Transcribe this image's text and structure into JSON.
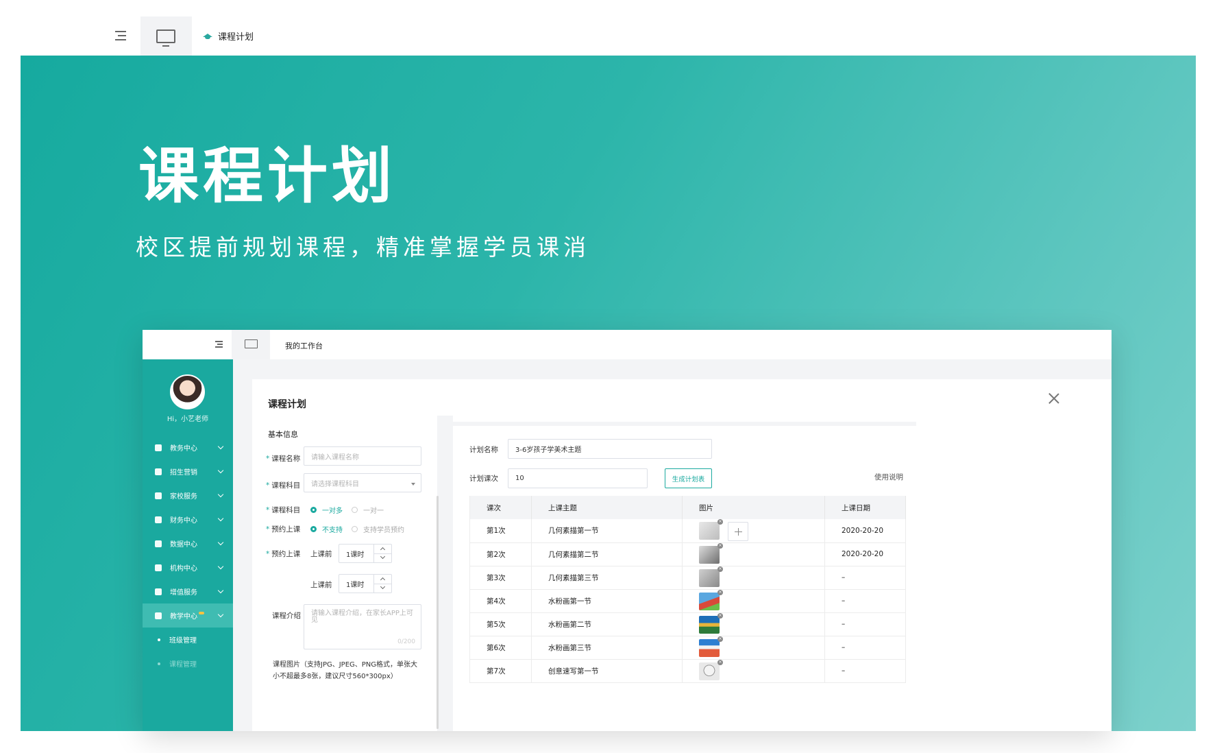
{
  "header": {
    "tab_label": "课程计划"
  },
  "hero": {
    "title": "课程计划",
    "subtitle": "校区提前规划课程，精准掌握学员课消"
  },
  "app": {
    "top_tab": "我的工作台",
    "greeting": "Hi，小艺老师",
    "nav": [
      {
        "label": "教务中心",
        "icon": "grid-icon"
      },
      {
        "label": "招生营销",
        "icon": "book-icon"
      },
      {
        "label": "家校服务",
        "icon": "heart-icon"
      },
      {
        "label": "财务中心",
        "icon": "wallet-icon"
      },
      {
        "label": "数据中心",
        "icon": "bar-chart-icon"
      },
      {
        "label": "机构中心",
        "icon": "building-icon"
      },
      {
        "label": "增值服务",
        "icon": "gem-icon"
      },
      {
        "label": "教学中心",
        "icon": "graduation-cap-icon"
      }
    ],
    "subnav": [
      "班级管理",
      "课程管理"
    ],
    "accent_color": "#1aa99f"
  },
  "panel": {
    "title": "课程计划",
    "section": "基本信息",
    "form": {
      "name_label": "课程名称",
      "name_placeholder": "请输入课程名称",
      "subject_label": "课程科目",
      "subject_placeholder": "请选择课程科目",
      "type_label": "课程科目",
      "type_options": [
        "一对多",
        "一对一"
      ],
      "book_label": "预约上课",
      "book_options": [
        "不支持",
        "支持学员预约"
      ],
      "book2_label": "预约上课",
      "before_label1": "上课前",
      "before_value1": "1课时",
      "before_label2": "上课前",
      "before_value2": "1课时",
      "intro_label": "课程介绍",
      "intro_placeholder": "请输入课程介绍，在家长APP上可见",
      "intro_counter": "0/200",
      "image_note": "课程图片（支持JPG、JPEG、PNG格式，单张大小不超最多8张，建议尺寸560*300px）"
    },
    "plan": {
      "name_label": "计划名称",
      "name_value": "3-6岁孩子学美术主题",
      "count_label": "计划课次",
      "count_value": "10",
      "generate_button": "生成计划表",
      "help_link": "使用说明"
    },
    "table": {
      "headers": [
        "课次",
        "上课主题",
        "图片",
        "上课日期"
      ],
      "rows": [
        {
          "no": "第1次",
          "topic": "几何素描第一节",
          "date": "2020-20-20"
        },
        {
          "no": "第2次",
          "topic": "几何素描第二节",
          "date": "2020-20-20"
        },
        {
          "no": "第3次",
          "topic": "几何素描第三节",
          "date": "–"
        },
        {
          "no": "第4次",
          "topic": "水粉画第一节",
          "date": "–"
        },
        {
          "no": "第5次",
          "topic": "水粉画第二节",
          "date": "–"
        },
        {
          "no": "第6次",
          "topic": "水粉画第三节",
          "date": "–"
        },
        {
          "no": "第7次",
          "topic": "创意速写第一节",
          "date": "–"
        }
      ]
    }
  }
}
